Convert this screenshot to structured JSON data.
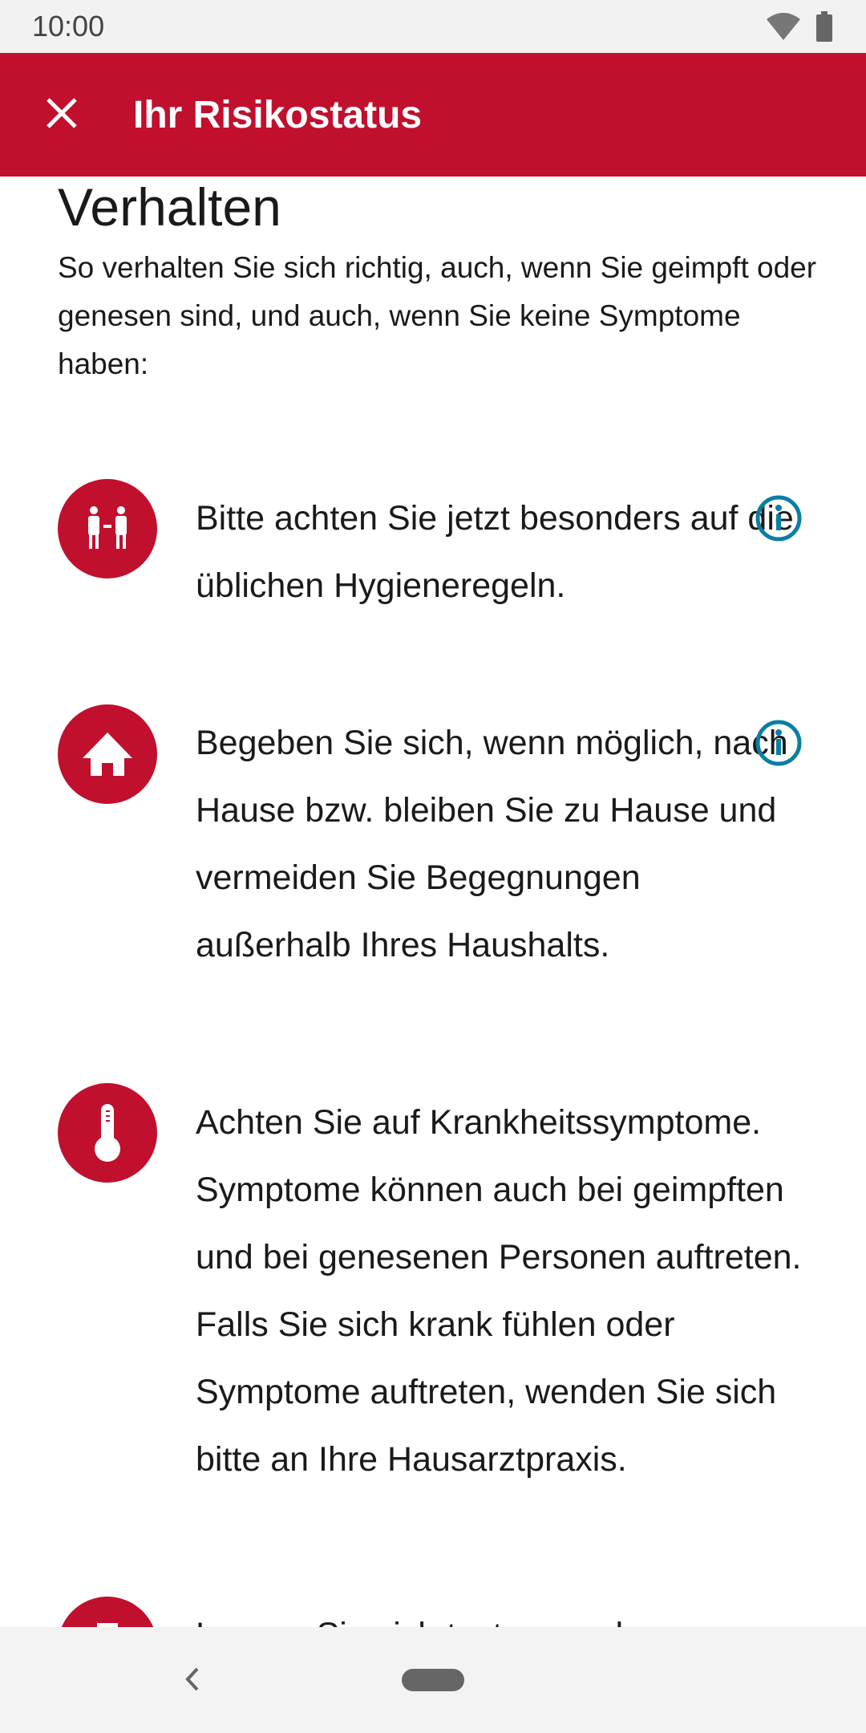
{
  "status_bar": {
    "time": "10:00",
    "icons": [
      "wifi-icon",
      "battery-icon"
    ]
  },
  "app_bar": {
    "title": "Ihr Risikostatus",
    "close_icon": "close-icon",
    "background": "#c0102e"
  },
  "content": {
    "heading": "Verhalten",
    "intro": "So verhalten Sie sich richtig, auch, wenn Sie geimpft oder genesen sind, und auch, wenn Sie keine Symptome haben:",
    "items": [
      {
        "icon": "distance-people-icon",
        "text": "Bitte achten Sie jetzt besonders auf die üblichen Hygieneregeln.",
        "has_info": true
      },
      {
        "icon": "home-icon",
        "text": "Begeben Sie sich, wenn möglich, nach Hause bzw. bleiben Sie zu Hause und vermeiden Sie Begegnungen außerhalb Ihres Haushalts.",
        "has_info": true
      },
      {
        "icon": "thermometer-icon",
        "text": "Achten Sie auf Krankheitssymptome. Symptome können auch bei geimpften und bei genesenen Personen auftreten. Falls Sie sich krank fühlen oder Symptome auftreten, wenden Sie sich bitte an Ihre Hausarztpraxis.",
        "has_info": false
      },
      {
        "icon": "test-tube-icon",
        "text": "Lassen Sie sich testen, auch",
        "has_info": false
      }
    ],
    "info_color": "#0a7ea4"
  },
  "nav_bar": {
    "back_icon": "back-icon",
    "home_icon": "home-pill-icon"
  }
}
